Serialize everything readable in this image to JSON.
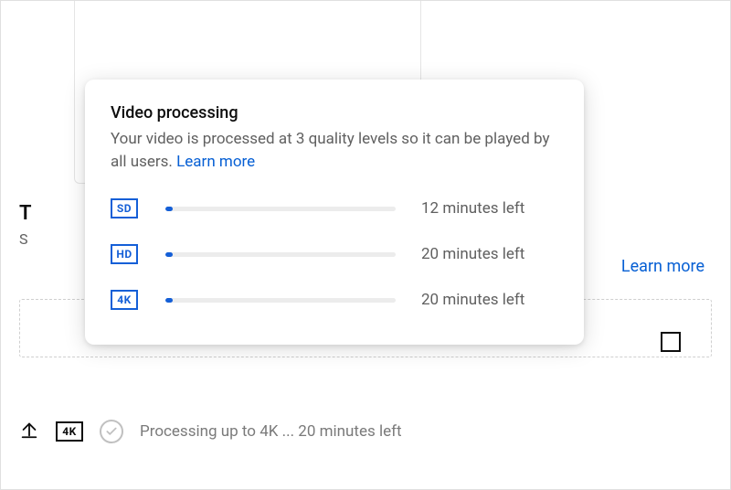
{
  "background": {
    "title_stub": "T",
    "subtitle_stub": "S",
    "learn_more_label": "Learn more"
  },
  "tooltip": {
    "title": "Video processing",
    "description": "Your video is processed at 3 quality levels so it can be played by all users. ",
    "learn_more_label": "Learn more",
    "qualities": [
      {
        "badge": "SD",
        "progress_pct": 3,
        "time_label": "12 minutes left"
      },
      {
        "badge": "HD",
        "progress_pct": 3,
        "time_label": "20 minutes left"
      },
      {
        "badge": "4K",
        "progress_pct": 3,
        "time_label": "20 minutes left"
      }
    ]
  },
  "status": {
    "badge": "4K",
    "text": "Processing up to 4K ... 20 minutes left"
  },
  "colors": {
    "accent": "#065fd4",
    "badge_blue": "#145fd7",
    "muted": "#606060"
  }
}
